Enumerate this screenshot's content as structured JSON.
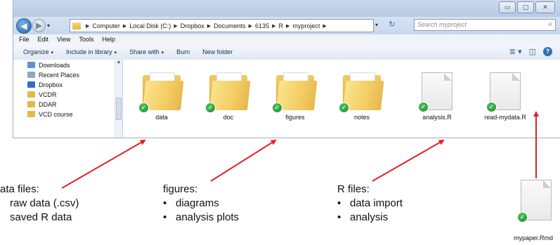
{
  "window": {
    "caption": {
      "minimize": "▭",
      "maximize": "▢",
      "close": "✕"
    },
    "nav": {
      "back": "◀",
      "forward": "▶",
      "dropdown": "▾"
    },
    "breadcrumbs": [
      "Computer",
      "Local Disk (C:)",
      "Dropbox",
      "Documents",
      "6135",
      "R",
      "myproject"
    ],
    "address_dropdown": "▾",
    "refresh": "↻",
    "search_placeholder": "Search myproject",
    "search_icon": "⌕",
    "menu": [
      "File",
      "Edit",
      "View",
      "Tools",
      "Help"
    ],
    "commands": [
      {
        "label": "Organize",
        "dropdown": "▾"
      },
      {
        "label": "Include in library",
        "dropdown": "▾"
      },
      {
        "label": "Share with",
        "dropdown": "▾"
      },
      {
        "label": "Burn",
        "dropdown": ""
      },
      {
        "label": "New folder",
        "dropdown": ""
      }
    ],
    "view_icons": [
      "≣ ▾",
      "◫"
    ],
    "help_icon": "?",
    "nav_pane": [
      {
        "label": "Downloads",
        "icon": "downloads-icon",
        "color": "#5b8fd6"
      },
      {
        "label": "Recent Places",
        "icon": "recent-places-icon",
        "color": "#8aa7c9"
      },
      {
        "label": "Dropbox",
        "icon": "dropbox-icon",
        "color": "#2a6fd1"
      },
      {
        "label": "VCDR",
        "icon": "folder-icon",
        "color": "#e4b84a"
      },
      {
        "label": "DDAR",
        "icon": "folder-icon",
        "color": "#e4b84a"
      },
      {
        "label": "VCD course",
        "icon": "folder-icon",
        "color": "#e4b84a"
      }
    ],
    "nav_scroll_up": "▲",
    "files": [
      {
        "name": "data",
        "type": "folder"
      },
      {
        "name": "doc",
        "type": "folder"
      },
      {
        "name": "figures",
        "type": "folder"
      },
      {
        "name": "notes",
        "type": "folder"
      },
      {
        "name": "analysis.R",
        "type": "document"
      },
      {
        "name": "read-mydata.R",
        "type": "document"
      }
    ],
    "sync_check": "✓"
  },
  "annotations": {
    "data_files": {
      "heading": "ata files:",
      "items": [
        "raw data (.csv)",
        "saved R data"
      ]
    },
    "figures": {
      "heading": "figures:",
      "items": [
        "diagrams",
        "analysis plots"
      ]
    },
    "r_files": {
      "heading": "R files:",
      "items": [
        "data import",
        "analysis"
      ]
    },
    "bullet": "•"
  },
  "external_file": {
    "name": "mypaper.Rmd",
    "check": "✓"
  },
  "colors": {
    "arrow": "#e0202a",
    "folder": "#f3cd62",
    "check": "#2fa53c",
    "window_frame": "#dfe7f1"
  }
}
